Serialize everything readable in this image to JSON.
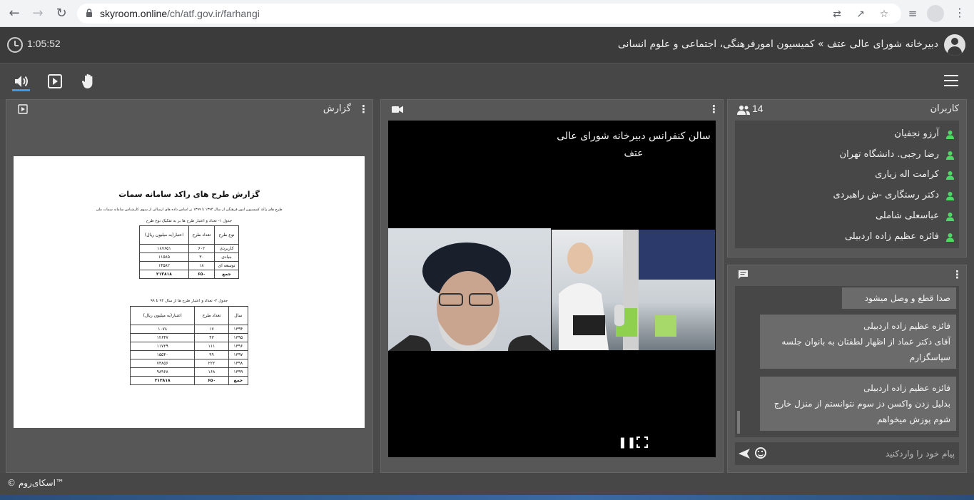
{
  "browser": {
    "url_host": "skyroom.online",
    "url_path": "/ch/atf.gov.ir/farhangi"
  },
  "header": {
    "timer": "1:05:52",
    "title": "دبیرخانه شورای عالی عتف » کمیسیون امورفرهنگی، اجتماعی و علوم انسانی"
  },
  "report": {
    "panel_title": "گزارش",
    "doc_title": "گزارش طرح های راکد سامانه سمات",
    "doc_subtitle": "طرح های راکد کمیسیون امور فرهنگی از سال ۱۳۹۴ تا ۱۳۹۹ بر اساس داده های ارسالی از سوی کارشناس سامانه سمات ملی",
    "table1": {
      "caption": "جدول ۱- تعداد و اعتبار طرح ها بر به تفکیک نوع طرح",
      "headers": [
        "نوع طرح",
        "تعداد طرح",
        "اعتبار(به میلیون ریال)"
      ],
      "rows": [
        [
          "کاربردی",
          "۶۰۲",
          "۱۸۷۶۵۱"
        ],
        [
          "بنیادی",
          "۳۰",
          "۱۱۵۸۵"
        ],
        [
          "توسعه ای",
          "۱۸",
          "۱۴۵۸۲"
        ]
      ],
      "total": [
        "جمع",
        "۶۵۰",
        "۲۱۳۸۱۸"
      ]
    },
    "table2": {
      "caption": "جدول ۲- تعداد و اعتبار طرح ها از سال ۹۴ تا ۹۹",
      "headers": [
        "سال",
        "تعداد طرح",
        "اعتبار(به میلیون ریال)"
      ],
      "rows": [
        [
          "۱۳۹۴",
          "۱۷",
          "۱۰۷۸"
        ],
        [
          "۱۳۹۵",
          "۴۳",
          "۱۲۶۴۷"
        ],
        [
          "۱۳۹۶",
          "۱۱۱",
          "۱۱۷۲۹"
        ],
        [
          "۱۳۹۷",
          "۹۹",
          "۱۵۵۴۰"
        ],
        [
          "۱۳۹۸",
          "۲۲۲",
          "۷۳۸۵۶"
        ],
        [
          "۱۳۹۹",
          "۱۶۸",
          "۹۸۹۶۸"
        ]
      ],
      "total": [
        "جمع",
        "۶۵۰",
        "۲۱۳۸۱۸"
      ]
    }
  },
  "video": {
    "caption_line1": "سالن کنفرانس دبیرخانه شورای عالی",
    "caption_line2": "عتف"
  },
  "users": {
    "panel_title": "کاربران",
    "count": "14",
    "status_color": "#4cd964",
    "list": [
      "آرزو نجفیان",
      "رضا رجبی. دانشگاه تهران",
      "کرامت اله زیاری",
      "دکتر رستگاری -ش راهبردی",
      "عباسعلی شاملی",
      "فائزه عظیم زاده اردبیلی"
    ]
  },
  "chat": {
    "messages": [
      {
        "author": "",
        "text": "صدا قطع و وصل میشود"
      },
      {
        "author": "فائزه عظیم زاده اردبیلی",
        "text": "آقای دکتر عماد از اظهار لطفتان به بانوان جلسه سپاسگزارم"
      },
      {
        "author": "فائزه عظیم زاده اردبیلی",
        "text": "بدلیل زدن واکسن دز سوم نتوانستم از منزل خارج شوم پوزش میخواهم"
      }
    ],
    "input_placeholder": "پیام خود را واردکنید"
  },
  "footer": {
    "copyright": "© اسکای‌روم™"
  }
}
